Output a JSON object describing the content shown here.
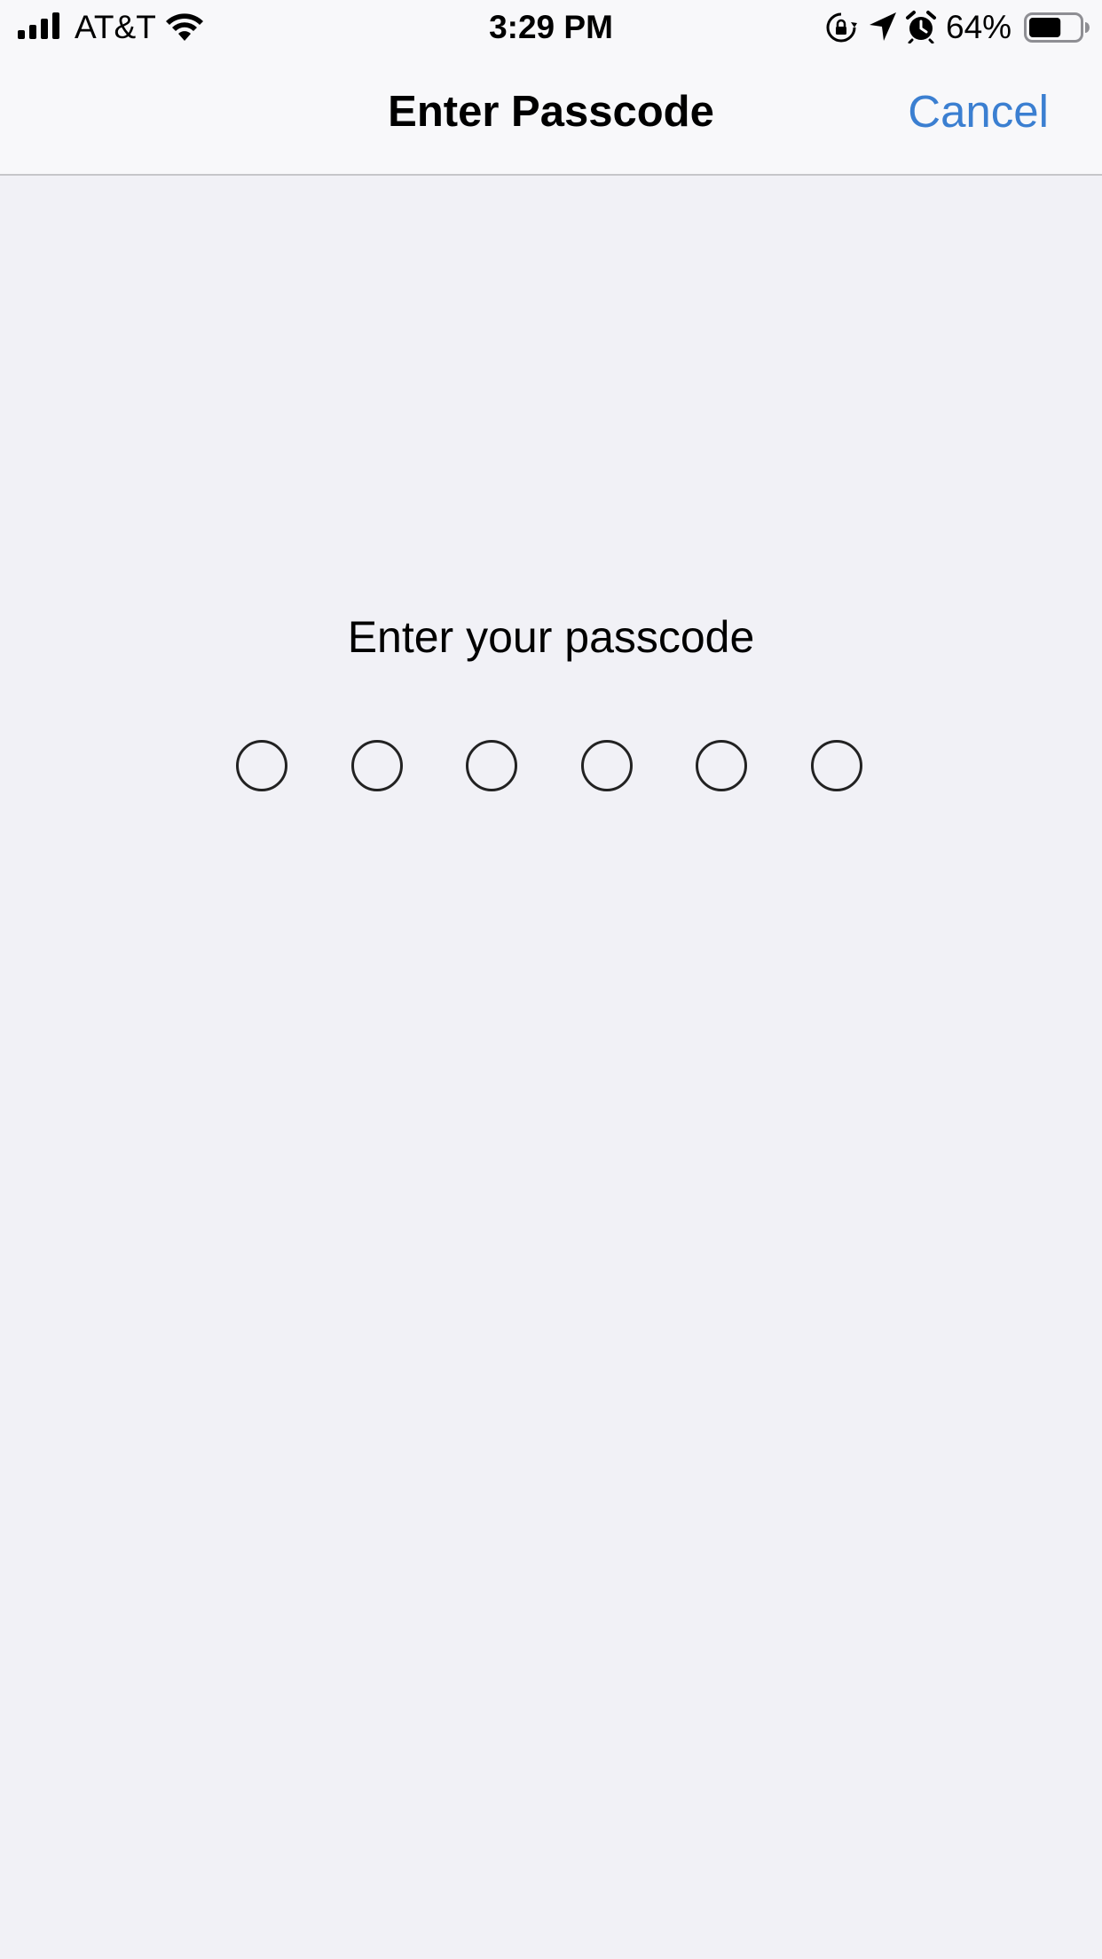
{
  "status_bar": {
    "carrier": "AT&T",
    "time": "3:29 PM",
    "battery_percent": "64%",
    "battery_level": 0.64,
    "icons": [
      "signal-icon",
      "wifi-icon",
      "rotation-lock-icon",
      "location-arrow-icon",
      "alarm-icon",
      "battery-icon"
    ]
  },
  "nav": {
    "title": "Enter Passcode",
    "cancel_label": "Cancel"
  },
  "passcode": {
    "prompt": "Enter your passcode",
    "digit_count": 6,
    "entered_count": 0
  },
  "colors": {
    "accent": "#3b7fd1",
    "background": "#f1f1f6",
    "nav_background": "#f8f8fa"
  }
}
